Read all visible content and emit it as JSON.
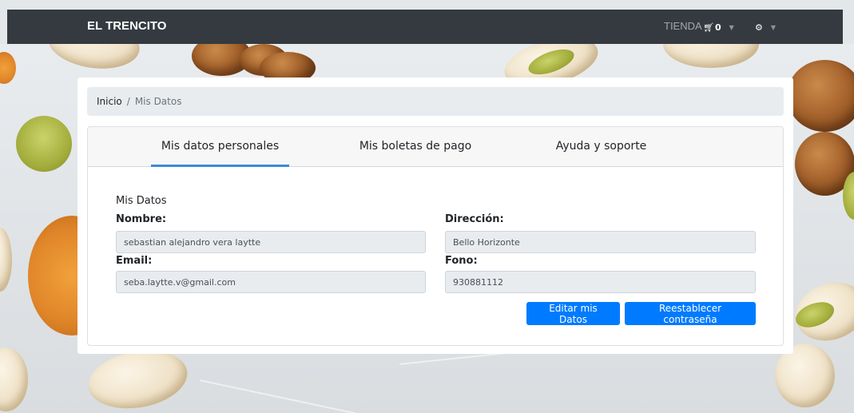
{
  "navbar": {
    "brand": "EL TRENCITO",
    "store_label": "TIENDA",
    "cart_icon": "cart-icon",
    "cart_count": "0",
    "settings_icon": "gear-icon"
  },
  "breadcrumb": {
    "home": "Inicio",
    "separator": "/",
    "current": "Mis Datos"
  },
  "tabs": [
    {
      "label": "Mis datos personales",
      "active": true
    },
    {
      "label": "Mis boletas de pago",
      "active": false
    },
    {
      "label": "Ayuda y soporte",
      "active": false
    }
  ],
  "form": {
    "title": "Mis Datos",
    "nombre_label": "Nombre:",
    "nombre_value": "sebastian alejandro vera laytte",
    "direccion_label": "Dirección:",
    "direccion_value": "Bello Horizonte",
    "email_label": "Email:",
    "email_value": "seba.laytte.v@gmail.com",
    "fono_label": "Fono:",
    "fono_value": "930881112"
  },
  "buttons": {
    "edit": "Editar mis Datos",
    "reset_password": "Reestablecer contraseña"
  },
  "colors": {
    "navbar": "#343a40",
    "primary": "#007bff",
    "tab_active_underline": "#3d8bd4"
  }
}
